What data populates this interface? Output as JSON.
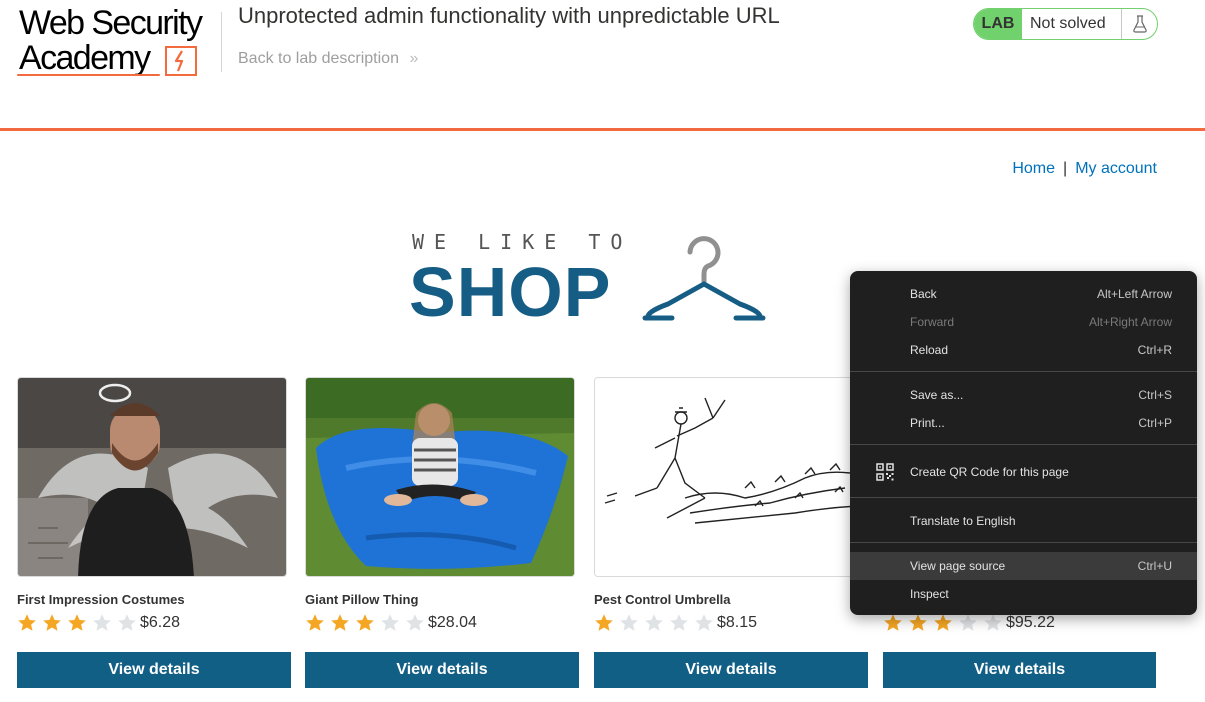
{
  "academy_header": {
    "logo_line1": "Web Security",
    "logo_line2": "Academy",
    "lab_title": "Unprotected admin functionality with unpredictable URL",
    "back_link": "Back to lab description",
    "lab_badge": "LAB",
    "lab_status": "Not solved"
  },
  "nav": {
    "home": "Home",
    "separator": "|",
    "my_account": "My account"
  },
  "banner": {
    "line1": "WE LIKE TO",
    "line2": "SHOP"
  },
  "products": [
    {
      "name": "First Impression Costumes",
      "rating": 3,
      "price": "$6.28",
      "button": "View details"
    },
    {
      "name": "Giant Pillow Thing",
      "rating": 3,
      "price": "$28.04",
      "button": "View details"
    },
    {
      "name": "Pest Control Umbrella",
      "rating": 1,
      "price": "$8.15",
      "button": "View details"
    },
    {
      "name": "",
      "rating": 3,
      "price": "$95.22",
      "button": "View details"
    }
  ],
  "context_menu": {
    "items": [
      {
        "label": "Back",
        "shortcut": "Alt+Left Arrow",
        "disabled": false
      },
      {
        "label": "Forward",
        "shortcut": "Alt+Right Arrow",
        "disabled": true
      },
      {
        "label": "Reload",
        "shortcut": "Ctrl+R",
        "disabled": false
      },
      {
        "label": "Save as...",
        "shortcut": "Ctrl+S",
        "disabled": false
      },
      {
        "label": "Print...",
        "shortcut": "Ctrl+P",
        "disabled": false
      },
      {
        "label": "Create QR Code for this page",
        "shortcut": "",
        "disabled": false,
        "icon": "qr-code-icon"
      },
      {
        "label": "Translate to English",
        "shortcut": "",
        "disabled": false
      },
      {
        "label": "View page source",
        "shortcut": "Ctrl+U",
        "disabled": false,
        "highlighted": true
      },
      {
        "label": "Inspect",
        "shortcut": "",
        "disabled": false
      }
    ]
  },
  "colors": {
    "accent_orange": "#f26a3d",
    "lab_green": "#70d16d",
    "button_blue": "#125f86",
    "link_blue": "#0071bc",
    "star_gold": "#f5a623",
    "star_empty": "#e0e3e6"
  }
}
